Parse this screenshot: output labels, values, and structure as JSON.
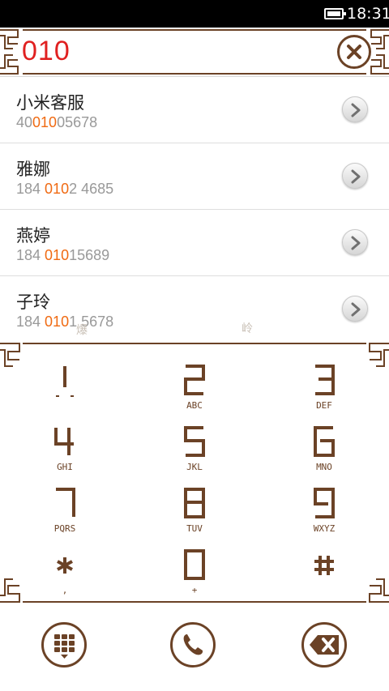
{
  "status_bar": {
    "time": "18:31"
  },
  "search": {
    "query": "010"
  },
  "results": [
    {
      "name": "小米客服",
      "num_before": "40",
      "num_match": "010",
      "num_after": "05678"
    },
    {
      "name": "雅娜",
      "num_before": "184 ",
      "num_match": "010",
      "num_after": "2 4685"
    },
    {
      "name": "燕婷",
      "num_before": "184 ",
      "num_match": "010",
      "num_after": "15689"
    },
    {
      "name": "子玲",
      "num_before": "184 ",
      "num_match": "010",
      "num_after": "1 5678"
    }
  ],
  "watermarks": [
    "爆",
    "岭"
  ],
  "dialpad": {
    "keys": [
      {
        "digit": "1",
        "letters": ""
      },
      {
        "digit": "2",
        "letters": "ABC"
      },
      {
        "digit": "3",
        "letters": "DEF"
      },
      {
        "digit": "4",
        "letters": "GHI"
      },
      {
        "digit": "5",
        "letters": "JKL"
      },
      {
        "digit": "6",
        "letters": "MNO"
      },
      {
        "digit": "7",
        "letters": "PQRS"
      },
      {
        "digit": "8",
        "letters": "TUV"
      },
      {
        "digit": "9",
        "letters": "WXYZ"
      },
      {
        "digit": "*",
        "letters": ","
      },
      {
        "digit": "0",
        "letters": "+"
      },
      {
        "digit": "#",
        "letters": ""
      }
    ]
  },
  "colors": {
    "accent_brown": "#6b4226",
    "query_red": "#e02020",
    "match_orange": "#f06a12"
  },
  "icons": {
    "clear": "close-icon",
    "arrow": "chevron-right-icon",
    "keypad": "keypad-icon",
    "call": "phone-icon",
    "backspace": "backspace-icon"
  }
}
